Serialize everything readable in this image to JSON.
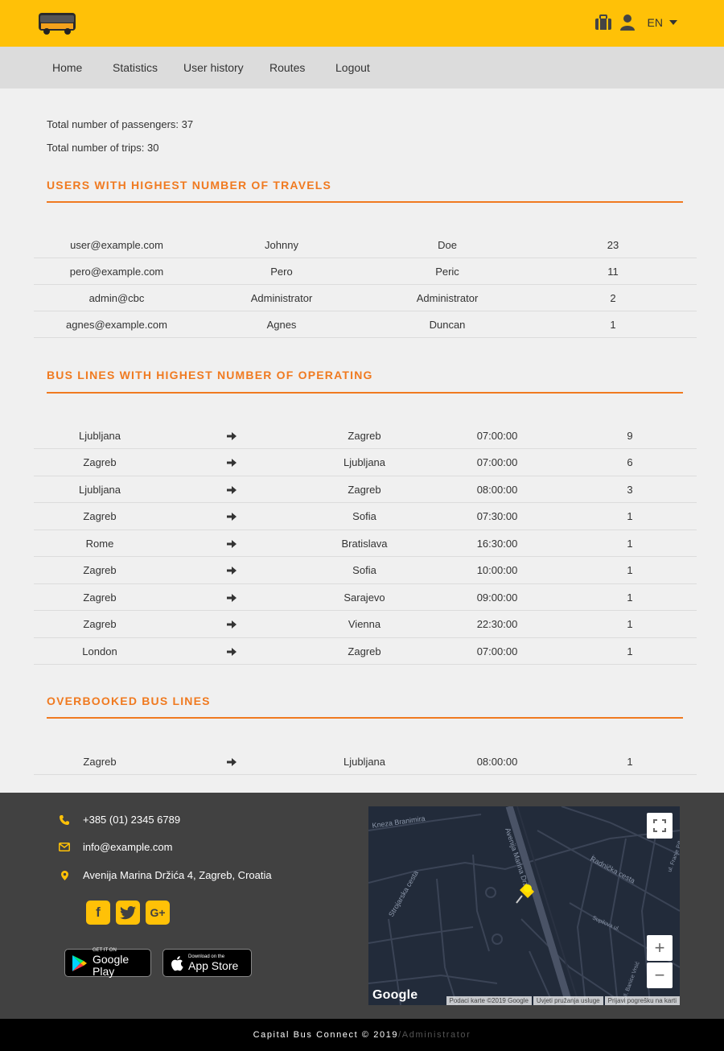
{
  "header": {
    "logo_icon": "bus-icon",
    "icons": [
      "briefcase-icon",
      "user-icon"
    ],
    "language": "EN"
  },
  "nav": {
    "items": [
      "Home",
      "Statistics",
      "User history",
      "Routes",
      "Logout"
    ]
  },
  "stats": {
    "passengers": "Total number of passengers: 37",
    "trips": "Total number of trips: 30"
  },
  "top_users": {
    "title": "USERS WITH HIGHEST NUMBER OF TRAVELS",
    "rows": [
      [
        "user@example.com",
        "Johnny",
        "Doe",
        "23"
      ],
      [
        "pero@example.com",
        "Pero",
        "Peric",
        "11"
      ],
      [
        "admin@cbc",
        "Administrator",
        "Administrator",
        "2"
      ],
      [
        "agnes@example.com",
        "Agnes",
        "Duncan",
        "1"
      ]
    ]
  },
  "top_lines": {
    "title": "BUS LINES WITH HIGHEST NUMBER OF OPERATING",
    "rows": [
      [
        "Ljubljana",
        "Zagreb",
        "07:00:00",
        "9"
      ],
      [
        "Zagreb",
        "Ljubljana",
        "07:00:00",
        "6"
      ],
      [
        "Ljubljana",
        "Zagreb",
        "08:00:00",
        "3"
      ],
      [
        "Zagreb",
        "Sofia",
        "07:30:00",
        "1"
      ],
      [
        "Rome",
        "Bratislava",
        "16:30:00",
        "1"
      ],
      [
        "Zagreb",
        "Sofia",
        "10:00:00",
        "1"
      ],
      [
        "Zagreb",
        "Sarajevo",
        "09:00:00",
        "1"
      ],
      [
        "Zagreb",
        "Vienna",
        "22:30:00",
        "1"
      ],
      [
        "London",
        "Zagreb",
        "07:00:00",
        "1"
      ]
    ]
  },
  "overbooked": {
    "title": "OVERBOOKED BUS LINES",
    "rows": [
      [
        "Zagreb",
        "Ljubljana",
        "08:00:00",
        "1"
      ]
    ]
  },
  "footer": {
    "phone": "+385 (01) 2345 6789",
    "email": "info@example.com",
    "address": "Avenija Marina Držića 4, Zagreb, Croatia",
    "social": [
      "facebook-icon",
      "twitter-icon",
      "google-plus-icon"
    ],
    "google_play_small": "GET IT ON",
    "google_play_big": "Google Play",
    "app_store_small": "Download on the",
    "app_store_big": "App Store",
    "map": {
      "streets": [
        "Kneza Branimira",
        "Avenija Marina Držića",
        "Radnička cesta",
        "Strojarska cesta",
        "Supilova ul.",
        "ul. Franje Pilleva",
        "Ul. Banice Vrsić"
      ],
      "google": "Google",
      "attribution": [
        "Podaci karte ©2019 Google",
        "Uvjeti pružanja usluge",
        "Prijavi pogrešku na karti"
      ]
    }
  },
  "bottombar": {
    "copyright": "Capital Bus Connect © 2019",
    "role": "/Administrator"
  },
  "colors": {
    "accent": "#ffc107",
    "section": "#f07a20",
    "footer_bg": "#414141"
  }
}
